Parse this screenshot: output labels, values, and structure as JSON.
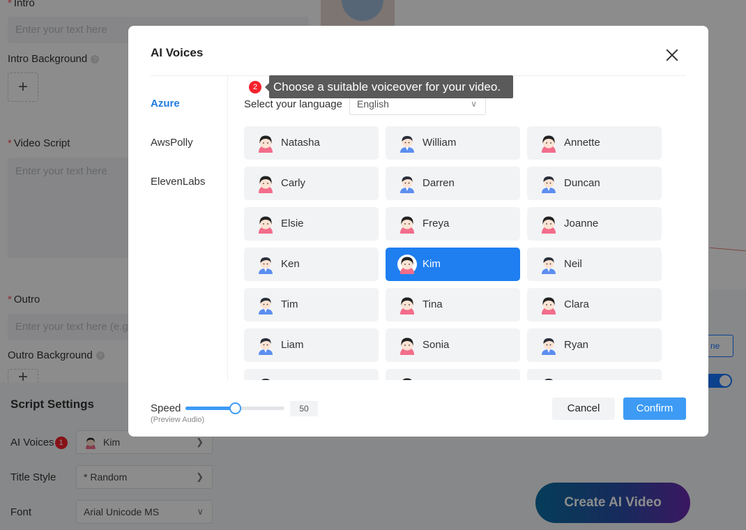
{
  "background": {
    "intro_label": "Intro",
    "intro_placeholder": "Enter your text here",
    "intro_bg_label": "Intro Background",
    "add_symbol": "+",
    "script_label": "Video Script",
    "script_placeholder": "Enter your text here",
    "outro_label": "Outro",
    "outro_placeholder": "Enter your text here (e.g",
    "outro_bg_label": "Outro Background",
    "help_symbol": "?",
    "settings_title": "Script Settings",
    "ai_voices_label": "AI Voices",
    "ai_voices_badge": "1",
    "ai_voices_value": "Kim",
    "title_style_label": "Title Style",
    "title_style_value": "* Random",
    "font_label": "Font",
    "font_value": "Arial Unicode MS",
    "outline_button_text": "ne",
    "create_button": "Create AI Video"
  },
  "modal": {
    "title": "AI Voices",
    "providers": [
      {
        "label": "Azure",
        "active": true
      },
      {
        "label": "AwsPolly",
        "active": false
      },
      {
        "label": "ElevenLabs",
        "active": false
      }
    ],
    "tooltip": {
      "badge": "2",
      "text": "Choose a suitable voiceover for your video."
    },
    "language": {
      "label": "Select your language",
      "value": "English"
    },
    "voices": [
      {
        "name": "Natasha",
        "gender": "female"
      },
      {
        "name": "William",
        "gender": "male"
      },
      {
        "name": "Annette",
        "gender": "female"
      },
      {
        "name": "Carly",
        "gender": "female"
      },
      {
        "name": "Darren",
        "gender": "male"
      },
      {
        "name": "Duncan",
        "gender": "male"
      },
      {
        "name": "Elsie",
        "gender": "female"
      },
      {
        "name": "Freya",
        "gender": "female"
      },
      {
        "name": "Joanne",
        "gender": "female"
      },
      {
        "name": "Ken",
        "gender": "male"
      },
      {
        "name": "Kim",
        "gender": "female",
        "selected": true
      },
      {
        "name": "Neil",
        "gender": "male"
      },
      {
        "name": "Tim",
        "gender": "male"
      },
      {
        "name": "Tina",
        "gender": "female"
      },
      {
        "name": "Clara",
        "gender": "female"
      },
      {
        "name": "Liam",
        "gender": "male"
      },
      {
        "name": "Sonia",
        "gender": "female"
      },
      {
        "name": "Ryan",
        "gender": "male"
      },
      {
        "name": "",
        "gender": "male"
      },
      {
        "name": "",
        "gender": "female"
      },
      {
        "name": "",
        "gender": "male"
      }
    ],
    "speed": {
      "label": "Speed",
      "sub_label": "(Preview Audio)",
      "value": "50",
      "max": 100
    },
    "cancel_label": "Cancel",
    "confirm_label": "Confirm"
  },
  "colors": {
    "accent": "#3d9bf5",
    "selected_voice": "#1f7ff0",
    "badge_red": "#f5222d"
  }
}
